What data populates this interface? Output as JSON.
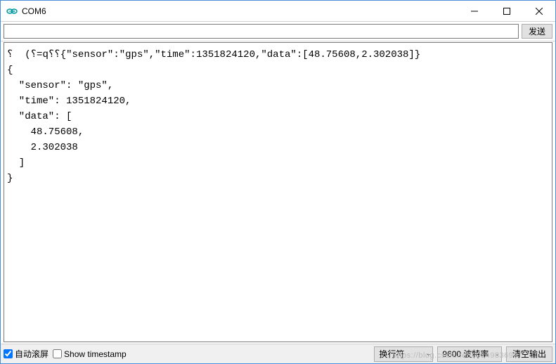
{
  "window": {
    "title": "COM6"
  },
  "inputRow": {
    "value": "",
    "sendLabel": "发送"
  },
  "console": {
    "text": "⸮  (⸮=q⸮⸮{\"sensor\":\"gps\",\"time\":1351824120,\"data\":[48.75608,2.302038]}\n{\n  \"sensor\": \"gps\",\n  \"time\": 1351824120,\n  \"data\": [\n    48.75608,\n    2.302038\n  ]\n}"
  },
  "bottom": {
    "autoscroll": {
      "label": "自动滚屏",
      "checked": true
    },
    "timestamp": {
      "label": "Show timestamp",
      "checked": false
    },
    "lineEnding": "换行符",
    "baud": "9600 波特率",
    "clearLabel": "清空输出"
  },
  "watermark": "https://blog.csdn.net/u014983699"
}
